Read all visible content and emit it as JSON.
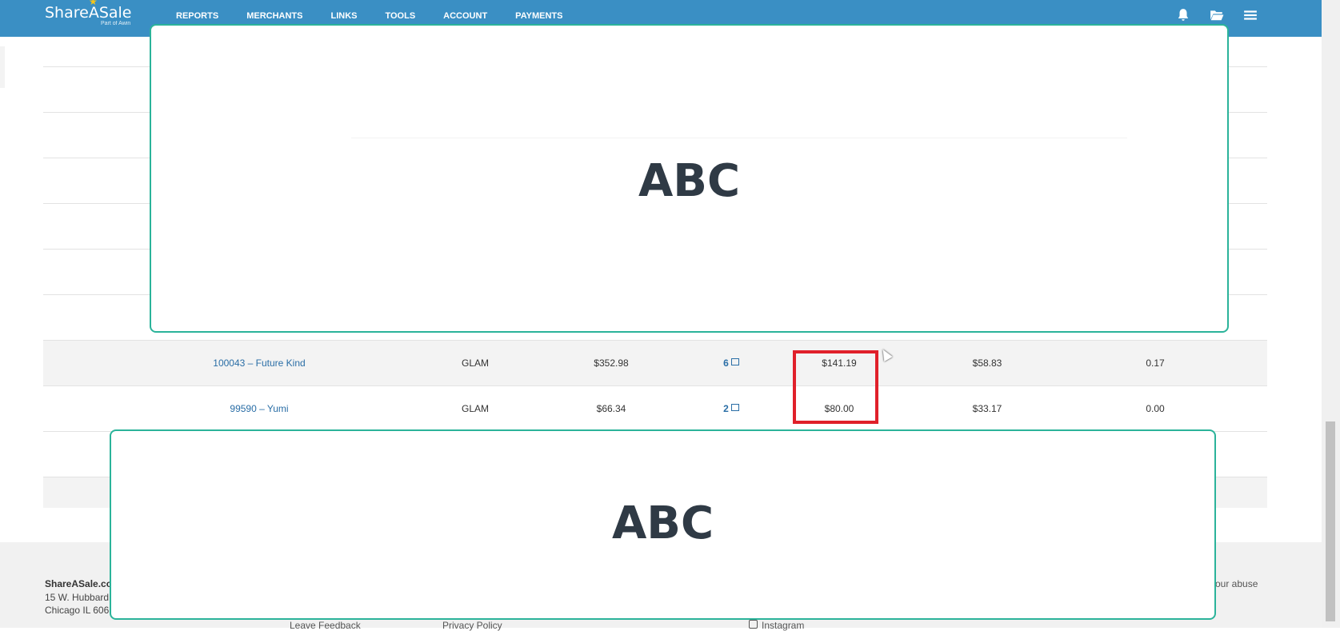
{
  "header": {
    "brand": "ShareASale",
    "brand_sub": "Part of Awin",
    "nav": [
      "REPORTS",
      "MERCHANTS",
      "LINKS",
      "TOOLS",
      "ACCOUNT",
      "PAYMENTS"
    ]
  },
  "table": {
    "rows": [
      {
        "merchant": "100043 – Future Kind",
        "category": "GLAM",
        "sales": "$352.98",
        "count": "6",
        "commission": "$141.19",
        "avg": "$58.83",
        "ratio": "0.17"
      },
      {
        "merchant": "99590 – Yumi",
        "category": "GLAM",
        "sales": "$66.34",
        "count": "2",
        "commission": "$80.00",
        "avg": "$33.17",
        "ratio": "0.00"
      }
    ]
  },
  "overlays": {
    "top_text": "ABC",
    "bottom_text": "ABC"
  },
  "footer": {
    "company": "ShareASale.co",
    "address1": "15 W. Hubbard",
    "address2": "Chicago IL 606",
    "links": [
      "Leave Feedback",
      "Privacy Policy",
      "Instagram"
    ],
    "right_text": "our abuse"
  },
  "colors": {
    "header": "#3a8fc4",
    "link": "#2a6ea6",
    "highlight": "#e0202a",
    "overlay_border": "#2bb39a"
  }
}
